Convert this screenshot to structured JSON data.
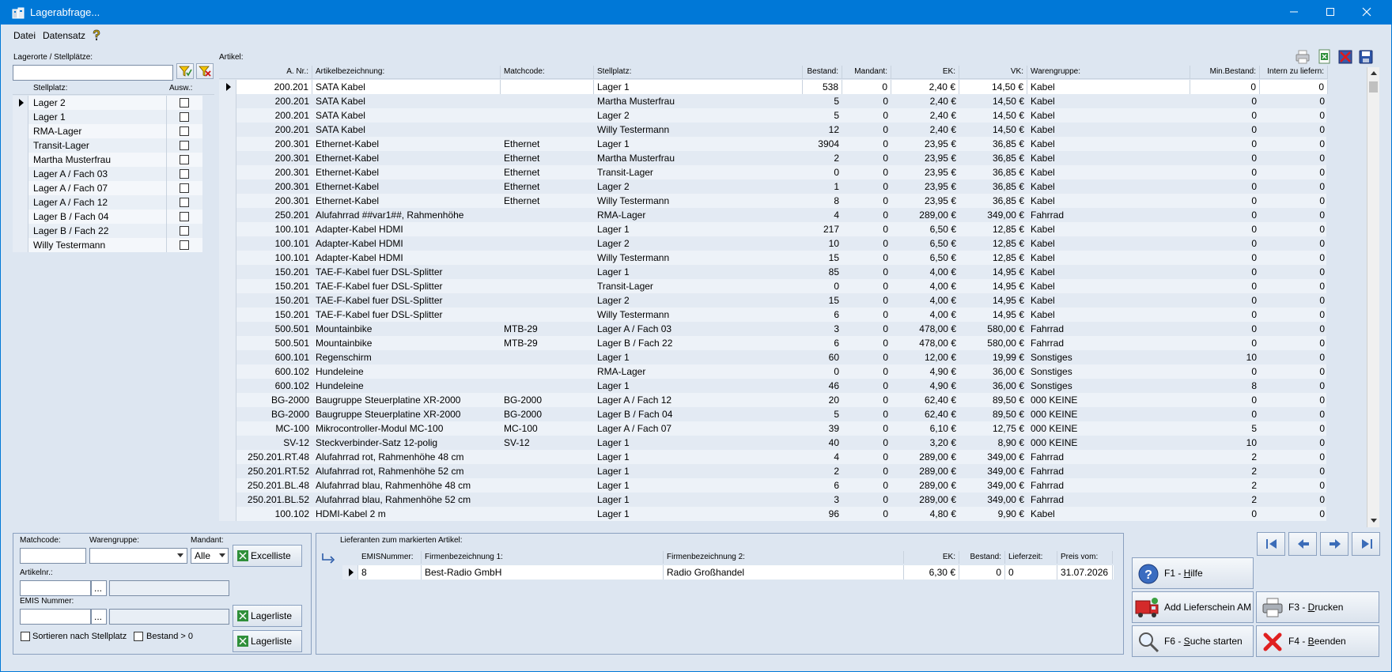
{
  "window": {
    "title": "Lagerabfrage..."
  },
  "menu": {
    "datei": "Datei",
    "datensatz": "Datensatz"
  },
  "left": {
    "label": "Lagerorte / Stellplätze:",
    "search_value": "",
    "col_stellplatz": "Stellplatz:",
    "col_ausw": "Ausw.:",
    "items": [
      {
        "name": "Lager 2",
        "checked": false
      },
      {
        "name": "Lager 1",
        "checked": false
      },
      {
        "name": "RMA-Lager",
        "checked": false
      },
      {
        "name": "Transit-Lager",
        "checked": false
      },
      {
        "name": "Martha Musterfrau",
        "checked": false
      },
      {
        "name": "Lager A / Fach 03",
        "checked": false
      },
      {
        "name": "Lager A / Fach 07",
        "checked": false
      },
      {
        "name": "Lager A / Fach 12",
        "checked": false
      },
      {
        "name": "Lager B / Fach 04",
        "checked": false
      },
      {
        "name": "Lager B / Fach 22",
        "checked": false
      },
      {
        "name": "Willy Testermann",
        "checked": false
      }
    ]
  },
  "artikel": {
    "label": "Artikel:",
    "columns": [
      "A. Nr.:",
      "Artikelbezeichnung:",
      "Matchcode:",
      "Stellplatz:",
      "Bestand:",
      "Mandant:",
      "EK:",
      "VK:",
      "Warengruppe:",
      "Min.Bestand:",
      "Intern zu liefern:"
    ],
    "rows": [
      [
        "200.201",
        "SATA Kabel",
        "",
        "Lager 1",
        "538",
        "0",
        "2,40 €",
        "14,50 €",
        "Kabel",
        "0",
        "0"
      ],
      [
        "200.201",
        "SATA Kabel",
        "",
        "Martha Musterfrau",
        "5",
        "0",
        "2,40 €",
        "14,50 €",
        "Kabel",
        "0",
        "0"
      ],
      [
        "200.201",
        "SATA Kabel",
        "",
        "Lager 2",
        "5",
        "0",
        "2,40 €",
        "14,50 €",
        "Kabel",
        "0",
        "0"
      ],
      [
        "200.201",
        "SATA Kabel",
        "",
        "Willy Testermann",
        "12",
        "0",
        "2,40 €",
        "14,50 €",
        "Kabel",
        "0",
        "0"
      ],
      [
        "200.301",
        "Ethernet-Kabel",
        "Ethernet",
        "Lager 1",
        "3904",
        "0",
        "23,95 €",
        "36,85 €",
        "Kabel",
        "0",
        "0"
      ],
      [
        "200.301",
        "Ethernet-Kabel",
        "Ethernet",
        "Martha Musterfrau",
        "2",
        "0",
        "23,95 €",
        "36,85 €",
        "Kabel",
        "0",
        "0"
      ],
      [
        "200.301",
        "Ethernet-Kabel",
        "Ethernet",
        "Transit-Lager",
        "0",
        "0",
        "23,95 €",
        "36,85 €",
        "Kabel",
        "0",
        "0"
      ],
      [
        "200.301",
        "Ethernet-Kabel",
        "Ethernet",
        "Lager 2",
        "1",
        "0",
        "23,95 €",
        "36,85 €",
        "Kabel",
        "0",
        "0"
      ],
      [
        "200.301",
        "Ethernet-Kabel",
        "Ethernet",
        "Willy Testermann",
        "8",
        "0",
        "23,95 €",
        "36,85 €",
        "Kabel",
        "0",
        "0"
      ],
      [
        "250.201",
        "Alufahrrad ##var1##, Rahmenhöhe",
        "",
        "RMA-Lager",
        "4",
        "0",
        "289,00 €",
        "349,00 €",
        "Fahrrad",
        "0",
        "0"
      ],
      [
        "100.101",
        "Adapter-Kabel HDMI",
        "",
        "Lager 1",
        "217",
        "0",
        "6,50 €",
        "12,85 €",
        "Kabel",
        "0",
        "0"
      ],
      [
        "100.101",
        "Adapter-Kabel HDMI",
        "",
        "Lager 2",
        "10",
        "0",
        "6,50 €",
        "12,85 €",
        "Kabel",
        "0",
        "0"
      ],
      [
        "100.101",
        "Adapter-Kabel HDMI",
        "",
        "Willy Testermann",
        "15",
        "0",
        "6,50 €",
        "12,85 €",
        "Kabel",
        "0",
        "0"
      ],
      [
        "150.201",
        "TAE-F-Kabel fuer DSL-Splitter",
        "",
        "Lager 1",
        "85",
        "0",
        "4,00 €",
        "14,95 €",
        "Kabel",
        "0",
        "0"
      ],
      [
        "150.201",
        "TAE-F-Kabel fuer DSL-Splitter",
        "",
        "Transit-Lager",
        "0",
        "0",
        "4,00 €",
        "14,95 €",
        "Kabel",
        "0",
        "0"
      ],
      [
        "150.201",
        "TAE-F-Kabel fuer DSL-Splitter",
        "",
        "Lager 2",
        "15",
        "0",
        "4,00 €",
        "14,95 €",
        "Kabel",
        "0",
        "0"
      ],
      [
        "150.201",
        "TAE-F-Kabel fuer DSL-Splitter",
        "",
        "Willy Testermann",
        "6",
        "0",
        "4,00 €",
        "14,95 €",
        "Kabel",
        "0",
        "0"
      ],
      [
        "500.501",
        "Mountainbike",
        "MTB-29",
        "Lager A / Fach 03",
        "3",
        "0",
        "478,00 €",
        "580,00 €",
        "Fahrrad",
        "0",
        "0"
      ],
      [
        "500.501",
        "Mountainbike",
        "MTB-29",
        "Lager B / Fach 22",
        "6",
        "0",
        "478,00 €",
        "580,00 €",
        "Fahrrad",
        "0",
        "0"
      ],
      [
        "600.101",
        "Regenschirm",
        "",
        "Lager 1",
        "60",
        "0",
        "12,00 €",
        "19,99 €",
        "Sonstiges",
        "10",
        "0"
      ],
      [
        "600.102",
        "Hundeleine",
        "",
        "RMA-Lager",
        "0",
        "0",
        "4,90 €",
        "36,00 €",
        "Sonstiges",
        "0",
        "0"
      ],
      [
        "600.102",
        "Hundeleine",
        "",
        "Lager 1",
        "46",
        "0",
        "4,90 €",
        "36,00 €",
        "Sonstiges",
        "8",
        "0"
      ],
      [
        "BG-2000",
        "Baugruppe Steuerplatine XR-2000",
        "BG-2000",
        "Lager A / Fach 12",
        "20",
        "0",
        "62,40 €",
        "89,50 €",
        "000 KEINE",
        "0",
        "0"
      ],
      [
        "BG-2000",
        "Baugruppe Steuerplatine XR-2000",
        "BG-2000",
        "Lager B / Fach 04",
        "5",
        "0",
        "62,40 €",
        "89,50 €",
        "000 KEINE",
        "0",
        "0"
      ],
      [
        "MC-100",
        "Mikrocontroller-Modul MC-100",
        "MC-100",
        "Lager A / Fach 07",
        "39",
        "0",
        "6,10 €",
        "12,75 €",
        "000 KEINE",
        "5",
        "0"
      ],
      [
        "SV-12",
        "Steckverbinder-Satz 12-polig",
        "SV-12",
        "Lager 1",
        "40",
        "0",
        "3,20 €",
        "8,90 €",
        "000 KEINE",
        "10",
        "0"
      ],
      [
        "250.201.RT.48",
        "Alufahrrad rot, Rahmenhöhe 48 cm",
        "",
        "Lager 1",
        "4",
        "0",
        "289,00 €",
        "349,00 €",
        "Fahrrad",
        "2",
        "0"
      ],
      [
        "250.201.RT.52",
        "Alufahrrad rot, Rahmenhöhe 52 cm",
        "",
        "Lager 1",
        "2",
        "0",
        "289,00 €",
        "349,00 €",
        "Fahrrad",
        "2",
        "0"
      ],
      [
        "250.201.BL.48",
        "Alufahrrad blau, Rahmenhöhe 48 cm",
        "",
        "Lager 1",
        "6",
        "0",
        "289,00 €",
        "349,00 €",
        "Fahrrad",
        "2",
        "0"
      ],
      [
        "250.201.BL.52",
        "Alufahrrad blau, Rahmenhöhe 52 cm",
        "",
        "Lager 1",
        "3",
        "0",
        "289,00 €",
        "349,00 €",
        "Fahrrad",
        "2",
        "0"
      ],
      [
        "100.102",
        "HDMI-Kabel 2 m",
        "",
        "Lager 1",
        "96",
        "0",
        "4,80 €",
        "9,90 €",
        "Kabel",
        "0",
        "0"
      ]
    ]
  },
  "filter": {
    "matchcode_label": "Matchcode:",
    "warengruppe_label": "Warengruppe:",
    "mandant_label": "Mandant:",
    "mandant_value": "Alle",
    "excelliste_label": "Excelliste",
    "artikelnr_label": "Artikelnr.:",
    "emis_label": "EMIS Nummer:",
    "dots": "...",
    "lagerliste1_label": "Lagerliste",
    "lagerliste2_label": "Lagerliste",
    "sort_label": "Sortieren nach Stellplatz",
    "bestand_label": "Bestand > 0"
  },
  "lieferanten": {
    "label": "Lieferanten zum markierten Artikel:",
    "columns": [
      "EMISNummer:",
      "Firmenbezeichnung 1:",
      "Firmenbezeichnung 2:",
      "EK:",
      "Bestand:",
      "Lieferzeit:",
      "Preis vom:"
    ],
    "rows": [
      [
        "8",
        "Best-Radio GmbH",
        "Radio Großhandel",
        "6,30 €",
        "0",
        "0",
        "31.07.2026"
      ]
    ]
  },
  "buttons": {
    "hilfe_pre": "F1 - ",
    "hilfe_u": "H",
    "hilfe_post": "ilfe",
    "lieferschein": "Add Lieferschein AM",
    "drucken_pre": "F3 - ",
    "drucken_u": "D",
    "drucken_post": "rucken",
    "suche_pre": "F6 - ",
    "suche_u": "S",
    "suche_post": "uche starten",
    "beenden_pre": "F4 - ",
    "beenden_u": "B",
    "beenden_post": "eenden"
  }
}
